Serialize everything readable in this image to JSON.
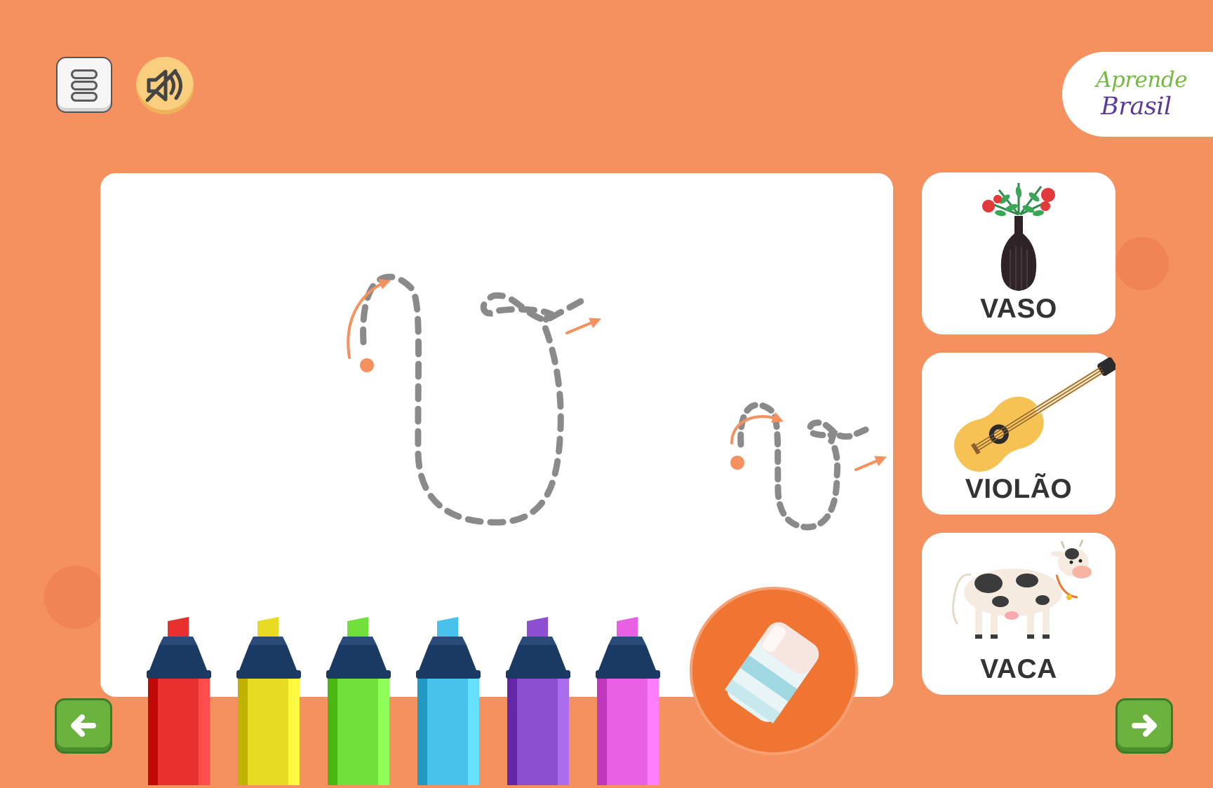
{
  "header": {
    "menu_icon": "menu-icon",
    "sound_icon": "sound-muted-icon",
    "brand": {
      "line1": "Aprende",
      "line2": "Brasil"
    }
  },
  "tracing": {
    "letter": "v",
    "guide_color": "#8a8a8a",
    "arrow_color": "#f4915e"
  },
  "cards": [
    {
      "label": "VASO",
      "icon": "vase-icon"
    },
    {
      "label": "VIOLÃO",
      "icon": "guitar-icon"
    },
    {
      "label": "VACA",
      "icon": "cow-icon"
    }
  ],
  "markers": [
    {
      "color": "red",
      "hex": "#e8302f"
    },
    {
      "color": "yellow",
      "hex": "#e8db24"
    },
    {
      "color": "green",
      "hex": "#72e03a"
    },
    {
      "color": "blue",
      "hex": "#48c2ea"
    },
    {
      "color": "purple",
      "hex": "#8c4fcf"
    },
    {
      "color": "pink",
      "hex": "#e860e4"
    }
  ],
  "tools": {
    "eraser_icon": "eraser-icon"
  },
  "navigation": {
    "prev_icon": "arrow-left-icon",
    "next_icon": "arrow-right-icon"
  },
  "colors": {
    "background": "#f4915e",
    "accent": "#f07432",
    "nav": "#6cb23f"
  }
}
